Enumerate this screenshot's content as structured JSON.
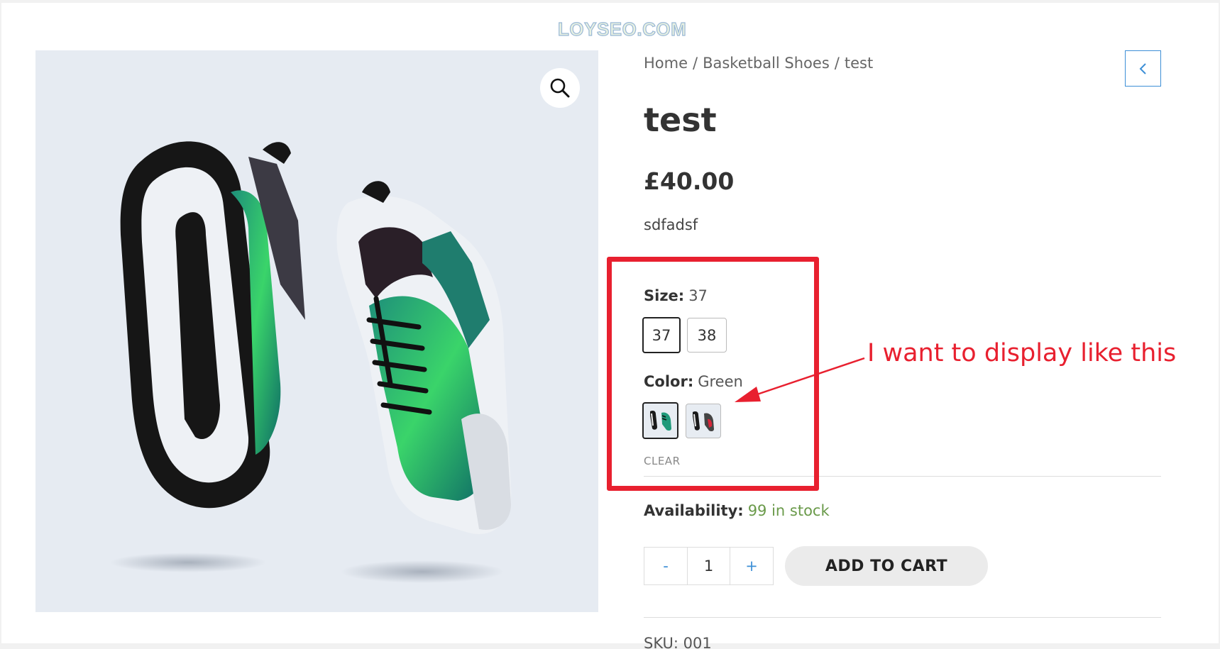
{
  "watermark": "LOYSEO.COM",
  "breadcrumb": {
    "home": "Home",
    "separator": "/",
    "category": "Basketball Shoes",
    "current": "test"
  },
  "product": {
    "title": "test",
    "price": "£40.00",
    "short_description": "sdfadsf"
  },
  "variations": {
    "size": {
      "label": "Size:",
      "selected": "37",
      "options": [
        "37",
        "38"
      ]
    },
    "color": {
      "label": "Color:",
      "selected": "Green",
      "options": [
        "Green",
        "Red"
      ]
    },
    "clear_label": "CLEAR"
  },
  "availability": {
    "label": "Availability:",
    "value": "99 in stock"
  },
  "cart": {
    "minus": "-",
    "quantity": "1",
    "plus": "+",
    "add_to_cart": "ADD TO CART"
  },
  "sku_partial": "SKU: 001",
  "annotation": {
    "text": "I want to display like this",
    "color": "#e8202f"
  },
  "colors": {
    "accent": "#3d8fd6",
    "stock": "#6a9a4a",
    "highlight": "#e8202f"
  },
  "icons": {
    "zoom": "search-icon",
    "back": "chevron-left-icon"
  }
}
